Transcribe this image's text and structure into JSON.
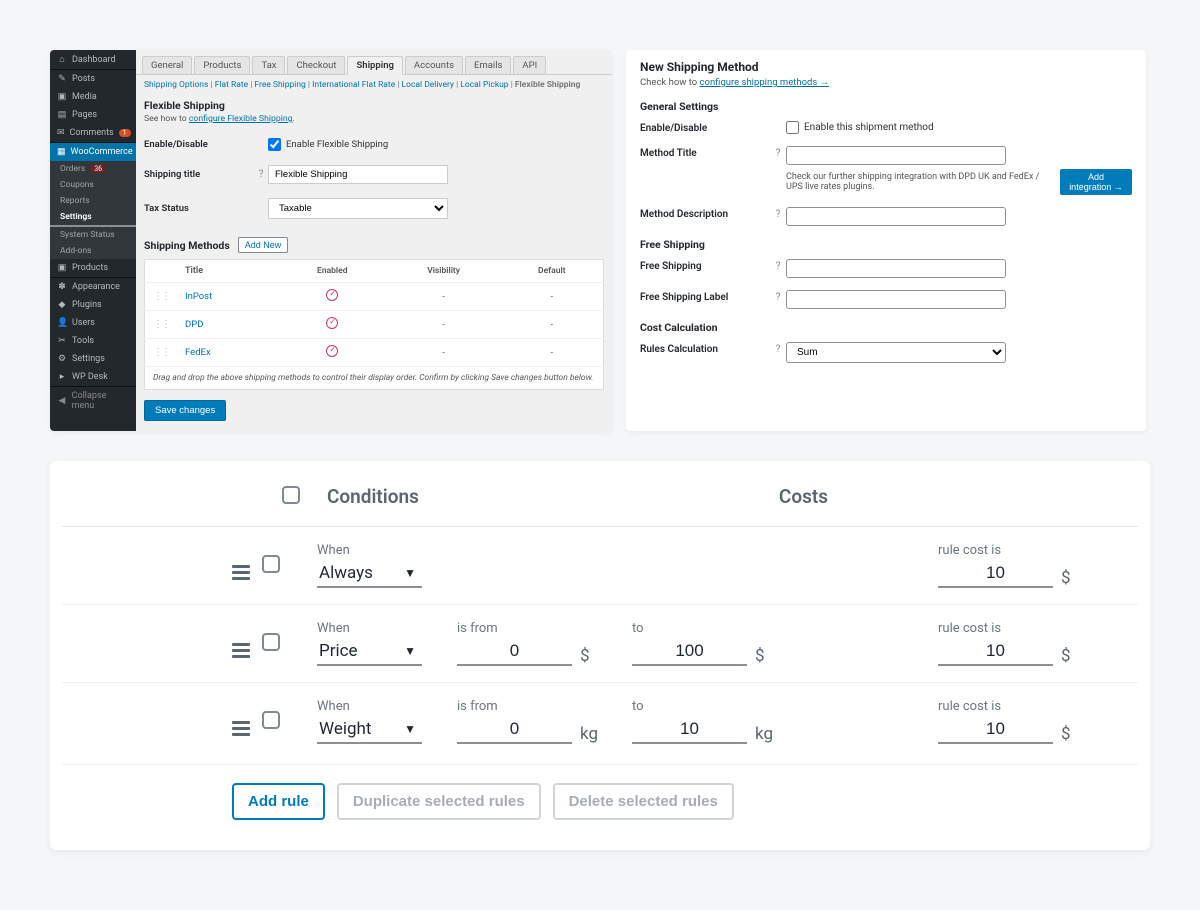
{
  "wp_sidebar": {
    "dashboard": "Dashboard",
    "posts": "Posts",
    "media": "Media",
    "pages": "Pages",
    "comments": "Comments",
    "comments_badge": "1",
    "woocommerce": "WooCommerce",
    "sub": {
      "orders": "Orders",
      "orders_badge": "36",
      "coupons": "Coupons",
      "reports": "Reports",
      "settings": "Settings",
      "system_status": "System Status",
      "addons": "Add-ons"
    },
    "products": "Products",
    "appearance": "Appearance",
    "plugins": "Plugins",
    "users": "Users",
    "tools": "Tools",
    "settings2": "Settings",
    "wpdesk": "WP Desk",
    "collapse": "Collapse menu"
  },
  "tabs": {
    "general": "General",
    "products": "Products",
    "tax": "Tax",
    "checkout": "Checkout",
    "shipping": "Shipping",
    "accounts": "Accounts",
    "emails": "Emails",
    "api": "API"
  },
  "crumbs": {
    "shipping_options": "Shipping Options",
    "flat_rate": "Flat Rate",
    "free_shipping": "Free Shipping",
    "intl_flat": "International Flat Rate",
    "local_delivery": "Local Delivery",
    "local_pickup": "Local Pickup",
    "flexible": "Flexible Shipping",
    "sep": " | "
  },
  "left": {
    "title": "Flexible Shipping",
    "hint_pre": "See how to ",
    "hint_link": "configure Flexible Shipping",
    "enable_lbl": "Enable/Disable",
    "enable_ck": "Enable Flexible Shipping",
    "shipping_title_lbl": "Shipping title",
    "shipping_title_val": "Flexible Shipping",
    "tax_lbl": "Tax Status",
    "tax_val": "Taxable",
    "methods_lbl": "Shipping Methods",
    "add_new": "Add New",
    "cols": {
      "title": "Title",
      "enabled": "Enabled",
      "visibility": "Visibility",
      "default": "Default"
    },
    "rows": [
      {
        "name": "InPost"
      },
      {
        "name": "DPD"
      },
      {
        "name": "FedEx"
      }
    ],
    "dash": "-",
    "note": "Drag and drop the above shipping methods to control their display order. Confirm by clicking Save changes button below.",
    "save": "Save changes"
  },
  "right": {
    "title": "New Shipping Method",
    "hint_pre": "Check how to ",
    "hint_link": "configure shipping methods →",
    "h_general": "General Settings",
    "enable_lbl": "Enable/Disable",
    "enable_ck": "Enable this shipment method",
    "method_title_lbl": "Method Title",
    "method_title_val": "",
    "method_desc_lbl": "Method Description",
    "method_desc_val": "",
    "integration_text": "Check our further shipping integration with DPD UK and FedEx / UPS live rates plugins.",
    "add_integration": "Add integration →",
    "h_free": "Free Shipping",
    "free_lbl": "Free Shipping",
    "free_val": "",
    "free_label_lbl": "Free Shipping Label",
    "free_label_val": "",
    "h_cost": "Cost Calculation",
    "rules_calc_lbl": "Rules Calculation",
    "rules_calc_val": "Sum"
  },
  "rules": {
    "h_conditions": "Conditions",
    "h_costs": "Costs",
    "lbl_when": "When",
    "lbl_from": "is from",
    "lbl_to": "to",
    "lbl_cost": "rule cost is",
    "opt_always": "Always",
    "opt_price": "Price",
    "opt_weight": "Weight",
    "unit_currency": "$",
    "unit_weight": "kg",
    "rows": [
      {
        "when": "Always",
        "from": null,
        "to": null,
        "cost": "10",
        "unit": "$"
      },
      {
        "when": "Price",
        "from": "0",
        "to": "100",
        "cost": "10",
        "unit": "$"
      },
      {
        "when": "Weight",
        "from": "0",
        "to": "10",
        "cost": "10",
        "unit": "kg"
      }
    ],
    "btn_add": "Add rule",
    "btn_dup": "Duplicate selected rules",
    "btn_del": "Delete selected rules"
  }
}
